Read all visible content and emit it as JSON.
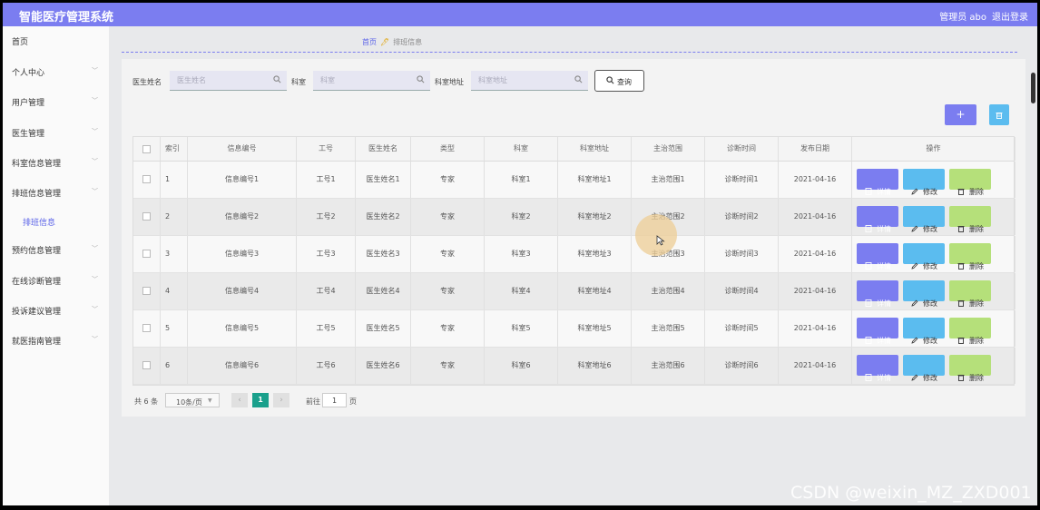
{
  "header": {
    "title": "智能医疗管理系统",
    "user": "管理员 abo",
    "logout": "退出登录"
  },
  "sidebar": {
    "items": [
      {
        "label": "首页",
        "has_children": false
      },
      {
        "label": "个人中心",
        "has_children": true
      },
      {
        "label": "用户管理",
        "has_children": true
      },
      {
        "label": "医生管理",
        "has_children": true
      },
      {
        "label": "科室信息管理",
        "has_children": true
      },
      {
        "label": "排班信息管理",
        "has_children": true
      },
      {
        "label": "排班信息",
        "has_children": false,
        "sub": true
      },
      {
        "label": "预约信息管理",
        "has_children": true
      },
      {
        "label": "在线诊断管理",
        "has_children": true
      },
      {
        "label": "投诉建议管理",
        "has_children": true
      },
      {
        "label": "就医指南管理",
        "has_children": true
      }
    ]
  },
  "breadcrumb": {
    "home": "首页",
    "current": "排班信息"
  },
  "filters": {
    "doctor_label": "医生姓名",
    "doctor_placeholder": "医生姓名",
    "dept_label": "科室",
    "dept_placeholder": "科室",
    "address_label": "科室地址",
    "address_placeholder": "科室地址",
    "query_button": "查询"
  },
  "toolbar": {
    "add_label": "+"
  },
  "table": {
    "columns": [
      "索引",
      "信息编号",
      "工号",
      "医生姓名",
      "类型",
      "科室",
      "科室地址",
      "主治范围",
      "诊断时间",
      "发布日期",
      "操作"
    ],
    "rows": [
      [
        "1",
        "信息编号1",
        "工号1",
        "医生姓名1",
        "专家",
        "科室1",
        "科室地址1",
        "主治范围1",
        "诊断时间1",
        "2021-04-16"
      ],
      [
        "2",
        "信息编号2",
        "工号2",
        "医生姓名2",
        "专家",
        "科室2",
        "科室地址2",
        "主治范围2",
        "诊断时间2",
        "2021-04-16"
      ],
      [
        "3",
        "信息编号3",
        "工号3",
        "医生姓名3",
        "专家",
        "科室3",
        "科室地址3",
        "主治范围3",
        "诊断时间3",
        "2021-04-16"
      ],
      [
        "4",
        "信息编号4",
        "工号4",
        "医生姓名4",
        "专家",
        "科室4",
        "科室地址4",
        "主治范围4",
        "诊断时间4",
        "2021-04-16"
      ],
      [
        "5",
        "信息编号5",
        "工号5",
        "医生姓名5",
        "专家",
        "科室5",
        "科室地址5",
        "主治范围5",
        "诊断时间5",
        "2021-04-16"
      ],
      [
        "6",
        "信息编号6",
        "工号6",
        "医生姓名6",
        "专家",
        "科室6",
        "科室地址6",
        "主治范围6",
        "诊断时间6",
        "2021-04-16"
      ]
    ],
    "actions": {
      "detail": "详情",
      "edit": "修改",
      "delete": "删除"
    }
  },
  "pager": {
    "total": "共 6 条",
    "page_size": "10条/页",
    "current_page": "1",
    "goto_label": "前往",
    "goto_value": "1",
    "goto_suffix": "页"
  },
  "watermark": "CSDN @weixin_MZ_ZXD001",
  "colors": {
    "accent": "#7b7df0",
    "edit": "#5bbcef",
    "delete": "#b5e07a",
    "pager_active": "#1aa08c"
  }
}
